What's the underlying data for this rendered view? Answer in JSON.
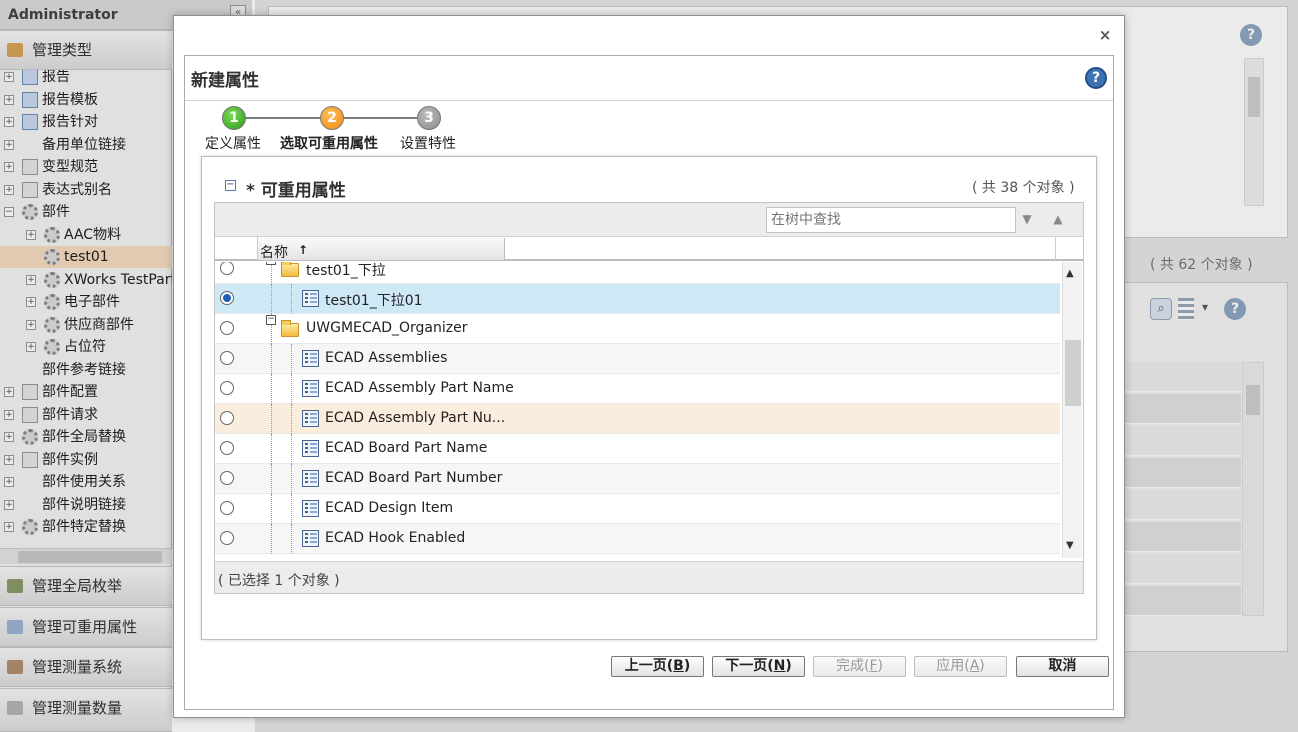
{
  "app": {
    "admin_label": "Administrator",
    "collapse_glyph": "«"
  },
  "sidebar": {
    "sections": [
      {
        "label": "管理类型",
        "icon": "box-icon"
      },
      {
        "label": "管理全局枚举",
        "icon": "list-icon"
      },
      {
        "label": "管理可重用属性",
        "icon": "attribute-icon"
      },
      {
        "label": "管理测量系统",
        "icon": "measure-system-icon"
      },
      {
        "label": "管理测量数量",
        "icon": "ruler-icon"
      }
    ],
    "tree": [
      {
        "label": "报告",
        "icon": "report-icon",
        "expand": "+"
      },
      {
        "label": "报告模板",
        "icon": "report-template-icon",
        "expand": "+"
      },
      {
        "label": "报告针对",
        "icon": "report-target-icon",
        "expand": "+"
      },
      {
        "label": "备用单位链接",
        "icon": "",
        "expand": "+"
      },
      {
        "label": "变型规范",
        "icon": "variant-spec-icon",
        "expand": "+"
      },
      {
        "label": "表达式别名",
        "icon": "expression-alias-icon",
        "expand": "+"
      },
      {
        "label": "部件",
        "icon": "gear-icon",
        "expand": "−"
      },
      {
        "label": "AAC物料",
        "icon": "gear-icon",
        "expand": "+"
      },
      {
        "label": "test01",
        "icon": "gear-icon",
        "expand": ""
      },
      {
        "label": "XWorks TestPart",
        "icon": "gear-icon",
        "expand": "+"
      },
      {
        "label": "电子部件",
        "icon": "gear-icon",
        "expand": "+"
      },
      {
        "label": "供应商部件",
        "icon": "gear-icon",
        "expand": "+"
      },
      {
        "label": "占位符",
        "icon": "gear-icon",
        "expand": "+"
      },
      {
        "label": "部件参考链接",
        "icon": "",
        "expand": ""
      },
      {
        "label": "部件配置",
        "icon": "part-config-icon",
        "expand": "+"
      },
      {
        "label": "部件请求",
        "icon": "part-request-icon",
        "expand": "+"
      },
      {
        "label": "部件全局替换",
        "icon": "gear-icon",
        "expand": "+"
      },
      {
        "label": "部件实例",
        "icon": "part-instance-icon",
        "expand": "+"
      },
      {
        "label": "部件使用关系",
        "icon": "",
        "expand": "+"
      },
      {
        "label": "部件说明链接",
        "icon": "",
        "expand": "+"
      },
      {
        "label": "部件特定替换",
        "icon": "gear-icon",
        "expand": "+"
      }
    ]
  },
  "background": {
    "count_text": "( 共 62 个对象 )",
    "help_glyph": "?"
  },
  "dialog": {
    "close_glyph": "×",
    "title": "新建属性",
    "help_glyph": "?",
    "steps": [
      {
        "number": "1",
        "label": "定义属性",
        "state": "done",
        "color": "#2e9b1a"
      },
      {
        "number": "2",
        "label": "选取可重用属性",
        "state": "current",
        "color": "#f08a10"
      },
      {
        "number": "3",
        "label": "设置特性",
        "state": "pending",
        "color": "#8a8a8a"
      }
    ],
    "section": {
      "toggle_glyph": "−",
      "title": "* 可重用属性",
      "count": "( 共 38 个对象 )"
    },
    "table": {
      "search_placeholder": "在树中查找",
      "column_name": "名称",
      "sort_glyph": "↑",
      "rows": [
        {
          "label": "test01_下拉",
          "kind": "folder",
          "level": 1,
          "selected": false
        },
        {
          "label": "test01_下拉01",
          "kind": "attribute",
          "level": 2,
          "selected": true
        },
        {
          "label": "UWGMECAD_Organizer",
          "kind": "folder",
          "level": 1,
          "selected": false
        },
        {
          "label": "ECAD Assemblies",
          "kind": "attribute",
          "level": 2,
          "selected": false
        },
        {
          "label": "ECAD Assembly Part Name",
          "kind": "attribute",
          "level": 2,
          "selected": false
        },
        {
          "label": "ECAD Assembly Part Nu...",
          "kind": "attribute",
          "level": 2,
          "selected": false,
          "hover": true
        },
        {
          "label": "ECAD Board Part Name",
          "kind": "attribute",
          "level": 2,
          "selected": false
        },
        {
          "label": "ECAD Board Part Number",
          "kind": "attribute",
          "level": 2,
          "selected": false
        },
        {
          "label": "ECAD Design Item",
          "kind": "attribute",
          "level": 2,
          "selected": false
        },
        {
          "label": "ECAD Hook Enabled",
          "kind": "attribute",
          "level": 2,
          "selected": false
        }
      ],
      "status": "( 已选择 1 个对象 )"
    },
    "buttons": [
      {
        "label": "上一页",
        "key": "B",
        "enabled": true
      },
      {
        "label": "下一页",
        "key": "N",
        "enabled": true
      },
      {
        "label": "完成",
        "key": "F",
        "enabled": false
      },
      {
        "label": "应用",
        "key": "A",
        "enabled": false
      },
      {
        "label": "取消",
        "key": "",
        "enabled": true
      }
    ]
  }
}
